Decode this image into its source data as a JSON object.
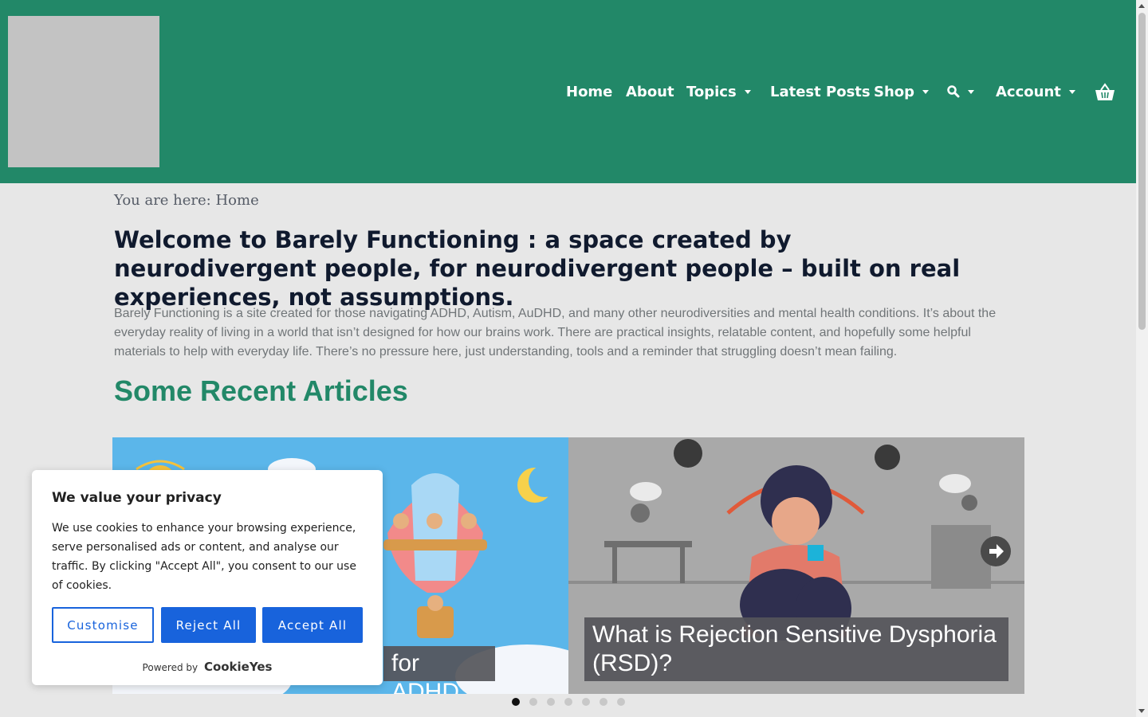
{
  "nav": {
    "items": [
      {
        "label": "Home",
        "dropdown": false
      },
      {
        "label": "About",
        "dropdown": false
      },
      {
        "label": "Topics",
        "dropdown": true
      },
      {
        "label": "Latest Posts",
        "dropdown": false
      },
      {
        "label": "Shop",
        "dropdown": true
      },
      {
        "label": "",
        "icon": "search-icon",
        "dropdown": true
      },
      {
        "label": "Account",
        "dropdown": true
      }
    ],
    "cart_icon": "basket-icon"
  },
  "breadcrumb": "You are here: Home",
  "page_title": "Welcome to Barely Functioning : a space created by neurodivergent people, for neurodivergent people – built on real experiences, not assumptions.",
  "intro": "Barely Functioning is a site created for those navigating ADHD, Autism, AuDHD, and many other neurodiversities and mental health conditions. It’s about the everyday reality of living in a world that isn’t designed for how our brains work. There are practical insights, relatable content, and hopefully some helpful materials to help with everyday life. There’s no pressure here, just understanding, tools and a reminder that struggling doesn’t mean failing.",
  "recent_title": "Some Recent Articles",
  "slider": {
    "slides": [
      {
        "caption": "for ADHD"
      },
      {
        "caption": "What is Rejection Sensitive Dysphoria (RSD)?"
      }
    ],
    "dot_count": 7,
    "active_dot": 0
  },
  "cookie": {
    "title": "We value your privacy",
    "text": "We use cookies to enhance your browsing experience, serve personalised ads or content, and analyse our traffic. By clicking \"Accept All\", you consent to our use of cookies.",
    "customise": "Customise",
    "reject": "Reject All",
    "accept": "Accept All",
    "powered_by": "Powered by",
    "brand": "CookieYes"
  },
  "colors": {
    "header": "#228868",
    "accent": "#228868",
    "button": "#1863dc"
  }
}
